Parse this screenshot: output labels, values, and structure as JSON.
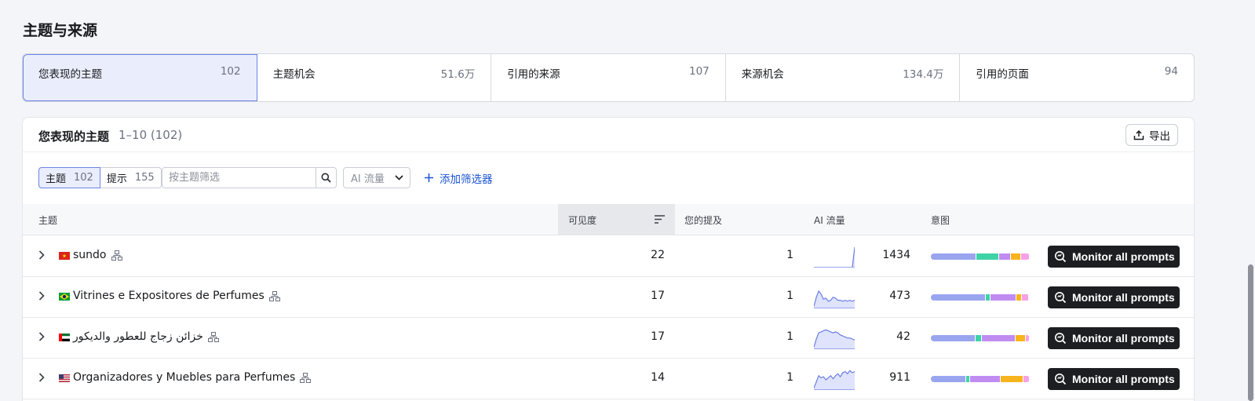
{
  "page_title": "主题与来源",
  "tabs": [
    {
      "label": "您表现的主题",
      "value": "102"
    },
    {
      "label": "主题机会",
      "value": "51.6万"
    },
    {
      "label": "引用的来源",
      "value": "107"
    },
    {
      "label": "来源机会",
      "value": "134.4万"
    },
    {
      "label": "引用的页面",
      "value": "94"
    }
  ],
  "card": {
    "title": "您表现的主题",
    "range": "1–10 (102)",
    "export_label": "导出"
  },
  "filters": {
    "seg_topics_label": "主题",
    "seg_topics_count": "102",
    "seg_prompts_label": "提示",
    "seg_prompts_count": "155",
    "search_placeholder": "按主题筛选",
    "ai_traffic_dropdown": "AI 流量",
    "add_filter": "添加筛选器"
  },
  "table": {
    "columns": {
      "topic": "主题",
      "visibility": "可见度",
      "mentions": "您的提及",
      "ai_traffic": "AI 流量",
      "intent": "意图"
    },
    "monitor_label": "Monitor all prompts",
    "intent_colors": [
      "#9aa5ef",
      "#3ed3a6",
      "#c08cf2",
      "#f8b41c",
      "#f6a0e7"
    ],
    "rows": [
      {
        "flag": "vn",
        "topic": "sundo",
        "visibility": "22",
        "mentions": "1",
        "traffic": "1434",
        "spark": [
          0,
          0,
          0,
          0,
          0,
          0,
          0,
          0,
          0,
          0,
          0,
          0,
          0,
          0,
          0,
          0,
          0,
          1
        ],
        "intent": [
          0.46,
          0.22,
          0.11,
          0.1,
          0.08
        ]
      },
      {
        "flag": "br",
        "topic": "Vitrines e Expositores de Perfumes",
        "visibility": "17",
        "mentions": "1",
        "traffic": "473",
        "spark": [
          0.1,
          0.55,
          0.85,
          0.7,
          0.45,
          0.5,
          0.35,
          0.4,
          0.55,
          0.5,
          0.4,
          0.4,
          0.35,
          0.4,
          0.35,
          0.4,
          0.35,
          0.4
        ],
        "intent": [
          0.55,
          0.04,
          0.25,
          0.05,
          0.06
        ]
      },
      {
        "flag": "ae",
        "topic": "خزائن زجاج للعطور والديكور",
        "visibility": "17",
        "mentions": "1",
        "traffic": "42",
        "spark": [
          0.1,
          0.5,
          0.8,
          0.85,
          0.9,
          0.95,
          0.9,
          0.85,
          0.8,
          0.85,
          0.8,
          0.7,
          0.65,
          0.6,
          0.55,
          0.55,
          0.5,
          0.45
        ],
        "intent": [
          0.45,
          0.06,
          0.34,
          0.1,
          0.03
        ]
      },
      {
        "flag": "us",
        "topic": "Organizadores y Muebles para Perfumes",
        "visibility": "14",
        "mentions": "1",
        "traffic": "911",
        "spark": [
          0.1,
          0.4,
          0.7,
          0.6,
          0.65,
          0.5,
          0.6,
          0.7,
          0.55,
          0.7,
          0.8,
          0.65,
          0.85,
          0.9,
          0.8,
          0.95,
          0.85,
          0.9
        ],
        "intent": [
          0.36,
          0.03,
          0.31,
          0.22,
          0.06
        ]
      }
    ]
  }
}
